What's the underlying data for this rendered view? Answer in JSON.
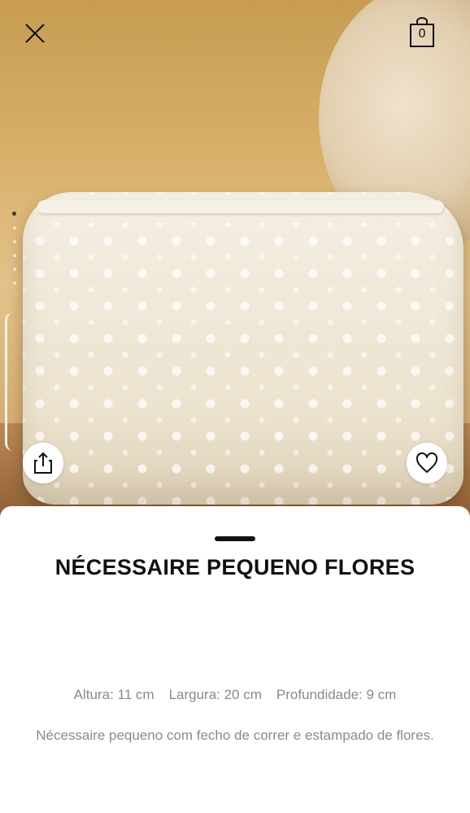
{
  "header": {
    "close_icon": "close-icon",
    "bag_icon": "shopping-bag-icon",
    "bag_count": "0"
  },
  "gallery": {
    "image_alt": "Nécessaire pequeno flores",
    "image_count": 6,
    "active_index": 1,
    "share_icon": "share-icon",
    "favorite_icon": "heart-icon"
  },
  "product": {
    "title": "NÉCESSAIRE PEQUENO FLORES",
    "faded_line_1": "",
    "faded_line_2": "",
    "dimensions": [
      {
        "label": "Altura: 11 cm"
      },
      {
        "label": "Largura: 20 cm"
      },
      {
        "label": "Profundidade: 9 cm"
      }
    ],
    "description": "Nécessaire pequeno com fecho de correr e estampado de flores."
  },
  "colors": {
    "text_primary": "#111111",
    "text_secondary": "#8a8a8a",
    "sheet_background": "#ffffff"
  }
}
